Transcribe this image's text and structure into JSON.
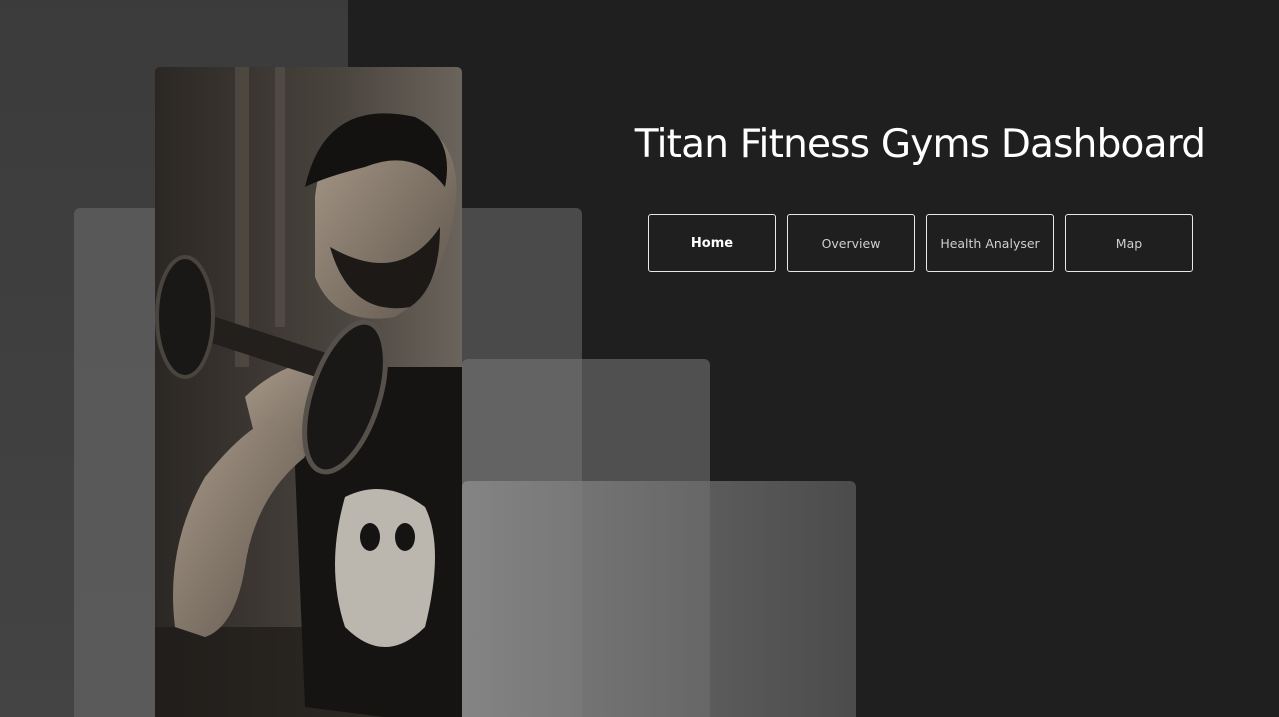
{
  "page": {
    "title": "Titan Fitness Gyms Dashboard"
  },
  "nav": {
    "items": [
      {
        "label": "Home",
        "active": true
      },
      {
        "label": "Overview",
        "active": false
      },
      {
        "label": "Health Analyser",
        "active": false
      },
      {
        "label": "Map",
        "active": false
      }
    ]
  },
  "hero_image": {
    "subject": "man lifting dumbbell, black and white photo"
  },
  "colors": {
    "background": "#1f1f1f",
    "text": "#ffffff",
    "button_border": "#e8e8e8"
  }
}
